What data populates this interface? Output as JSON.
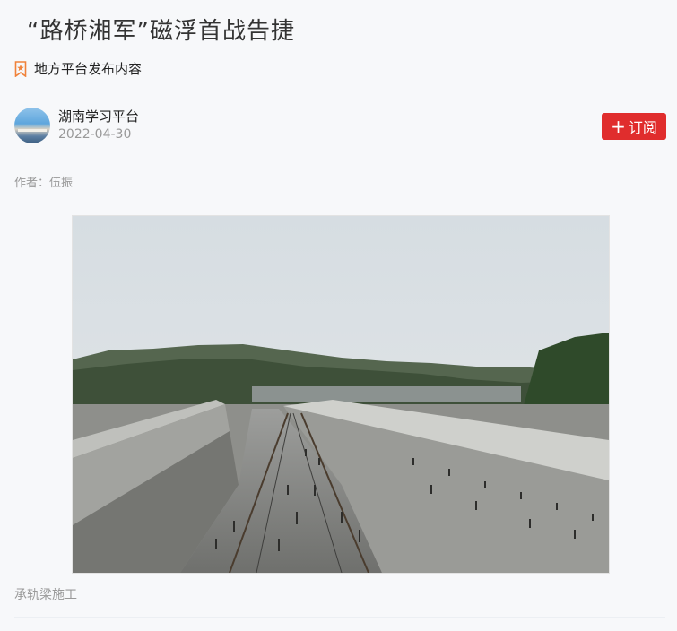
{
  "article": {
    "title": "“路桥湘军”磁浮首战告捷",
    "source_label": "地方平台发布内容",
    "publisher_name": "湖南学习平台",
    "publish_date": "2022-04-30",
    "subscribe_icon": "+",
    "subscribe_label": "订阅",
    "author_line": "作者：伍振",
    "image_caption": "承轨梁施工"
  },
  "icons": {
    "source": "bookmark-star-icon",
    "subscribe": "plus-icon"
  },
  "colors": {
    "accent": "#e02d2d",
    "background": "#f7f8fa",
    "muted_text": "#999999",
    "source_icon": "#f0823a"
  }
}
